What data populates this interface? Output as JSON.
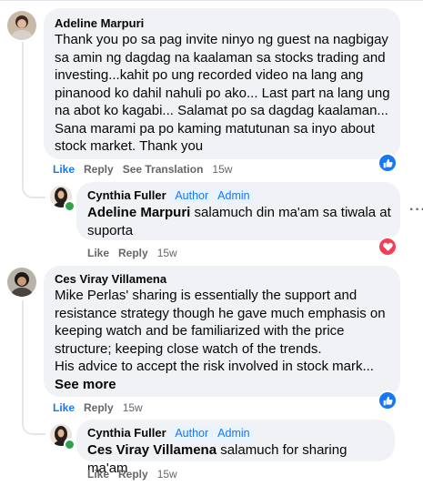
{
  "comments": [
    {
      "author": "Adeline Marpuri",
      "text": "Thank you po sa pag invite ninyo ng guest na nagbigay\nsa amin ng dagdag na kaalaman sa stocks trading and\ninvesting...kahit po ung recorded video na lang ang\npinanood ko dahil nahuli po ako... Last part na lang ung\nna abot ko kagabi... Salamat po sa dagdag kaalaman...\nSana marami pa po kaming matutunan sa inyo about\nstock market. Thank you",
      "actions": {
        "like": "Like",
        "reply": "Reply",
        "translate": "See Translation",
        "time": "15w"
      },
      "reaction": "like-icon",
      "reply": {
        "author": "Cynthia Fuller",
        "badges": [
          "Author",
          "Admin"
        ],
        "mention": "Adeline Marpuri",
        "text": " salamuch din ma'am sa tiwala at\nsuporta",
        "actions": {
          "like": "Like",
          "reply": "Reply",
          "time": "15w"
        },
        "reaction": "love-icon",
        "more": "···"
      }
    },
    {
      "author": "Ces Viray Villamena",
      "text": "Mike Perlas' sharing is essentially the support and\nresistance strategy though he gave much emphasis on\nkeeping watch and be familiarized with the price\nstructure; keeping close watch of the trends.\nHis advice to accept the risk involved in stock mark...",
      "see_more": "See more",
      "actions": {
        "like": "Like",
        "reply": "Reply",
        "time": "15w"
      },
      "reaction": "like-icon",
      "reply": {
        "author": "Cynthia Fuller",
        "badges": [
          "Author",
          "Admin"
        ],
        "mention": "Ces Viray Villamena",
        "text": " salamuch for sharing ma'am",
        "actions": {
          "like": "Like",
          "reply": "Reply",
          "time": "15w"
        }
      }
    }
  ],
  "colors": {
    "accent": "#1877f2",
    "bubble": "#f0f2f5",
    "muted": "#65676b",
    "love": "#f33e58",
    "online": "#31a24c"
  }
}
